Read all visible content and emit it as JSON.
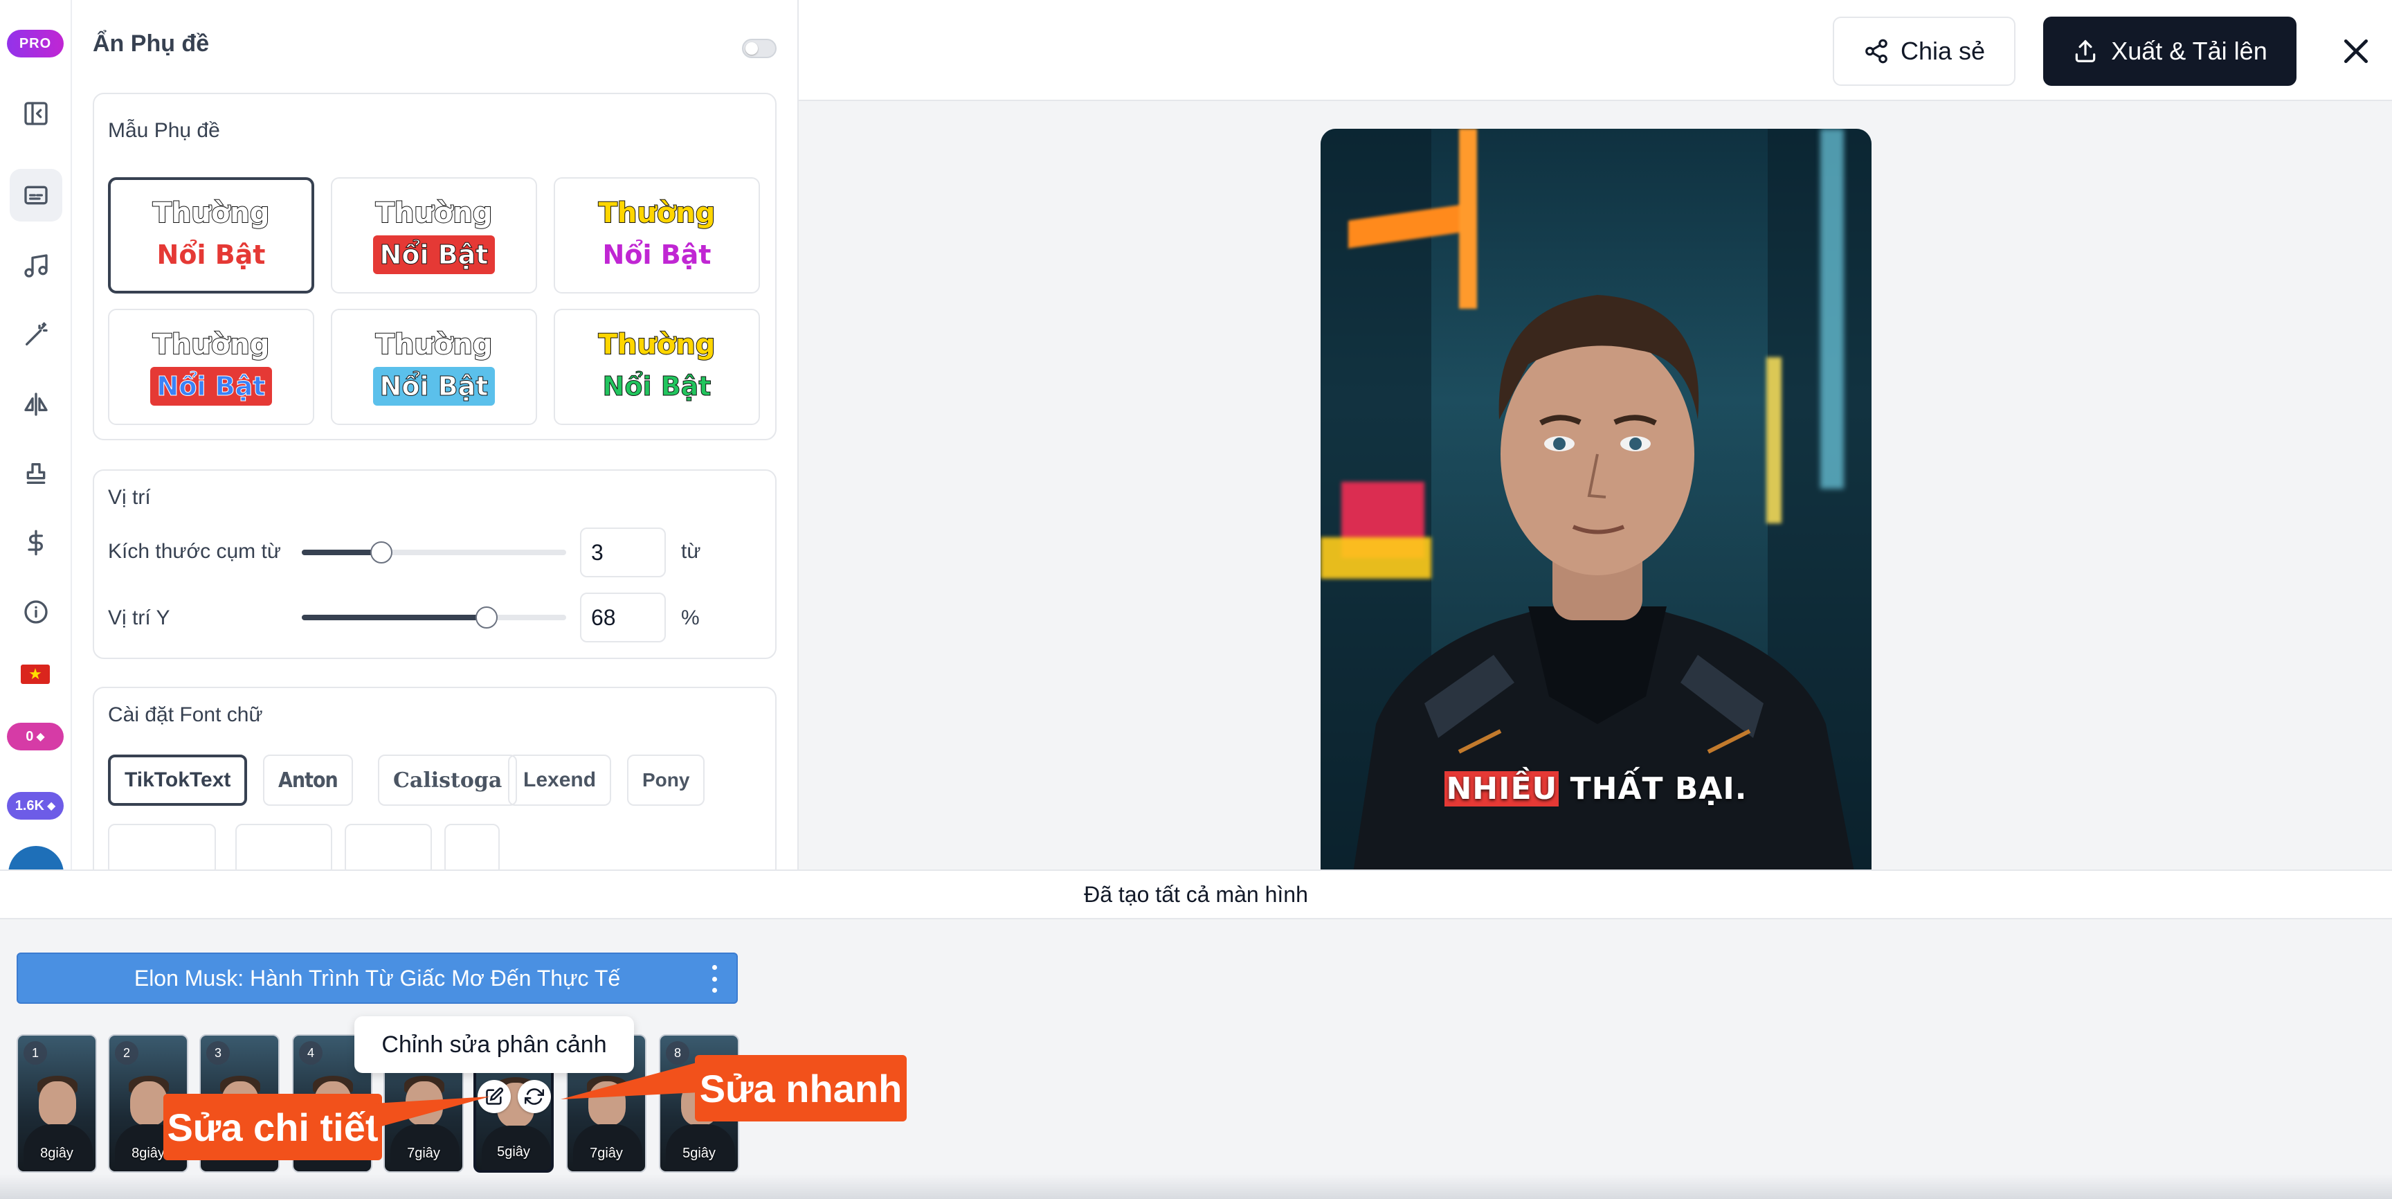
{
  "rail": {
    "pro_badge": "PRO",
    "credits": "0",
    "credits_color": "#d63ba6",
    "gems": "1.6K",
    "gems_color": "#6d5ce7",
    "icons": [
      "sidebar-collapse-icon",
      "subtitles-icon",
      "music-icon",
      "magic-wand-icon",
      "flip-icon",
      "stamp-icon",
      "dollar-icon",
      "info-icon",
      "vietnam-flag-icon"
    ]
  },
  "panel": {
    "title": "Ẩn Phụ đề",
    "templates_section": {
      "title": "Mẫu Phụ đề",
      "items": [
        {
          "top": "Thường",
          "bottom": "Nổi Bật"
        },
        {
          "top": "Thường",
          "bottom": "Nổi Bật"
        },
        {
          "top": "Thường",
          "bottom": "Nổi Bật"
        },
        {
          "top": "Thường",
          "bottom": "Nổi Bật"
        },
        {
          "top": "Thường",
          "bottom": "Nổi Bật"
        },
        {
          "top": "Thường",
          "bottom": "Nổi Bật"
        }
      ]
    },
    "position_section": {
      "title": "Vị trí",
      "phrase_size_label": "Kích thước cụm từ",
      "phrase_size_value": "3",
      "phrase_size_unit": "từ",
      "phrase_size_level": 0.3,
      "y_label": "Vị trí Y",
      "y_value": "68",
      "y_unit": "%",
      "y_level": 0.7
    },
    "font_section": {
      "title": "Cài đặt Font chữ",
      "fonts": [
        "TikTokText",
        "Anton",
        "Calistoga",
        "Lexend",
        "Pony"
      ],
      "selected": "TikTokText"
    }
  },
  "topbar": {
    "share_label": "Chia sẻ",
    "export_label": "Xuất & Tải lên"
  },
  "preview": {
    "caption_highlight": "NHIỀU",
    "caption_rest": "THẤT BẠI."
  },
  "status_text": "Đã tạo tất cả màn hình",
  "timeline": {
    "track_title": "Elon Musk: Hành Trình Từ Giấc Mơ Đến Thực Tế",
    "scenes": [
      {
        "num": "1",
        "duration": "8giây"
      },
      {
        "num": "2",
        "duration": "8giây"
      },
      {
        "num": "3",
        "duration": ""
      },
      {
        "num": "4",
        "duration": ""
      },
      {
        "num": "",
        "duration": "7giây"
      },
      {
        "num": "",
        "duration": "5giây"
      },
      {
        "num": "",
        "duration": "7giây"
      },
      {
        "num": "8",
        "duration": "5giây"
      }
    ],
    "tooltip": "Chỉnh sửa phân cảnh",
    "callout_detail": "Sửa chi tiết",
    "callout_quick": "Sửa nhanh"
  },
  "colors": {
    "accent_dark": "#111827",
    "track_blue": "#4a90e2",
    "callout_orange": "#f2511b",
    "caption_highlight": "#e53935"
  }
}
